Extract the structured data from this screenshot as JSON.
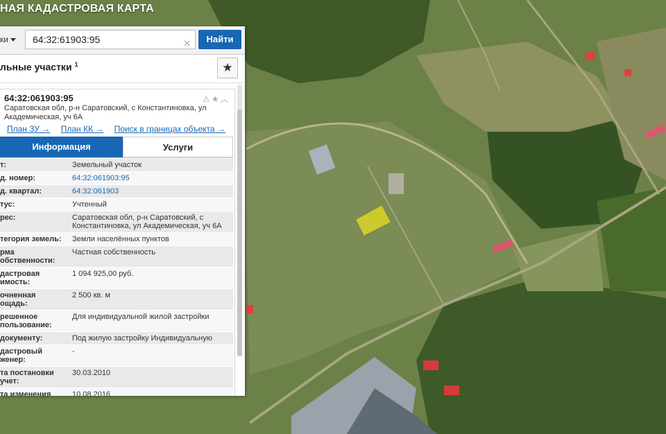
{
  "app": {
    "title": "НАЯ КАДАСТРОВАЯ КАРТА"
  },
  "search": {
    "type_label": "ки",
    "value": "64:32:61903:95",
    "clear_icon": "close-icon",
    "button_label": "Найти"
  },
  "layer": {
    "title": "льные участки",
    "sup": "1",
    "fav_icon": "star-icon"
  },
  "card": {
    "id": "64:32:061903:95",
    "address": "Саратовская обл, р-н Саратовский, с Константиновка, ул Академическая, уч 6А",
    "icons": "⚠★︿",
    "links": [
      "План ЗУ →",
      "План КК →",
      "Поиск в границах объекта →"
    ],
    "tabs": [
      "Информация",
      "Услуги"
    ]
  },
  "rows": [
    {
      "k": "т:",
      "v": "Земельный участок"
    },
    {
      "k": "д. номер:",
      "v": "64:32:061903:95"
    },
    {
      "k": "д. квартал:",
      "v": "64:32:061903"
    },
    {
      "k": "тус:",
      "v": "Учтенный"
    },
    {
      "k": "рес:",
      "v": "Саратовская обл, р-н Саратовский, с Константиновка, ул Академическая, уч 6А"
    },
    {
      "k": "тегория земель:",
      "v": "Земли населённых пунктов"
    },
    {
      "k": "рма\nобственности:",
      "v": "Частная собственность"
    },
    {
      "k": "дастровая\nимость:",
      "v": "1 094 925,00 руб."
    },
    {
      "k": "очненная\nощадь:",
      "v": "2 500 кв. м"
    },
    {
      "k": "решенное\nпользование:",
      "v": "Для индивидуальной жилой застройки"
    },
    {
      "k": "документу:",
      "v": "Под жилую застройку Индивидуальную"
    },
    {
      "k": "дастровый\nженер:",
      "v": "-"
    },
    {
      "k": "та постановки\nучет:",
      "v": "30.03.2010"
    },
    {
      "k": "та изменения\nдений в ГКН:",
      "v": "10.08.2016"
    }
  ],
  "colors": {
    "accent": "#1767b4",
    "parcel": "#e6e020"
  }
}
